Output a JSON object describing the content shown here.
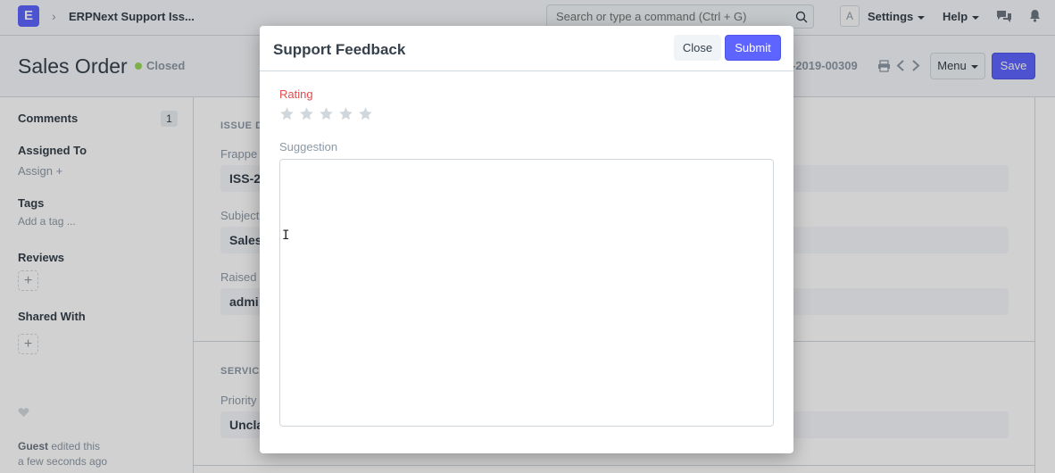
{
  "navbar": {
    "app_letter": "E",
    "breadcrumb": "ERPNext Support Iss...",
    "search_placeholder": "Search or type a command (Ctrl + G)",
    "avatar_letter": "A",
    "settings_label": "Settings",
    "help_label": "Help"
  },
  "page": {
    "title": "Sales Order",
    "status": "Closed",
    "doc_name": "-2019-00309",
    "menu_label": "Menu",
    "save_label": "Save"
  },
  "sidebar": {
    "comments_label": "Comments",
    "comments_count": "1",
    "assigned_to_label": "Assigned To",
    "assign_label": "Assign +",
    "tags_label": "Tags",
    "add_tag_label": "Add a tag ...",
    "reviews_label": "Reviews",
    "shared_with_label": "Shared With",
    "activity_user": "Guest",
    "activity_action": " edited this",
    "activity_time": "a few seconds ago"
  },
  "form": {
    "section_issue": "ISSUE D",
    "field_frappe_label": "Frappe I",
    "field_frappe_value": "ISS-2",
    "field_subject_label": "Subject",
    "field_subject_value": "Sales",
    "field_raised_label": "Raised B",
    "field_raised_value": "admi",
    "section_service": "SERVICE",
    "field_priority_label": "Priority",
    "field_priority_value": "Uncla"
  },
  "modal": {
    "title": "Support Feedback",
    "close_label": "Close",
    "submit_label": "Submit",
    "rating_label": "Rating",
    "rating_value": 0,
    "rating_max": 5,
    "suggestion_label": "Suggestion",
    "suggestion_value": ""
  },
  "colors": {
    "primary": "#5e64ff",
    "status_closed": "#98d85b",
    "rating_label": "#e24c4c",
    "star_empty": "#d1d8dd"
  }
}
